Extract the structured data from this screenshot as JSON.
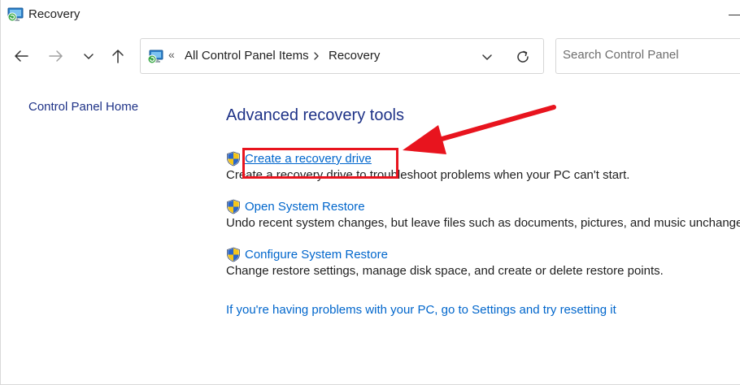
{
  "window": {
    "title": "Recovery"
  },
  "address_bar": {
    "overflow_glyph": "«",
    "crumbs": [
      "All Control Panel Items",
      "Recovery"
    ]
  },
  "search": {
    "placeholder": "Search Control Panel"
  },
  "left_pane": {
    "home_link": "Control Panel Home"
  },
  "main": {
    "title": "Advanced recovery tools",
    "tasks": [
      {
        "link": "Create a recovery drive",
        "description": "Create a recovery drive to troubleshoot problems when your PC can't start."
      },
      {
        "link": "Open System Restore",
        "description": "Undo recent system changes, but leave files such as documents, pictures, and music unchanged."
      },
      {
        "link": "Configure System Restore",
        "description": "Change restore settings, manage disk space, and create or delete restore points."
      }
    ],
    "reset_link": "If you're having problems with your PC, go to Settings and try resetting it"
  },
  "icons": {
    "title": "recovery-icon",
    "back": "arrow-left-icon",
    "forward": "arrow-right-icon",
    "recent": "chevron-down-icon",
    "up": "arrow-up-icon",
    "address_dropdown": "chevron-down-icon",
    "refresh": "refresh-icon",
    "task": "uac-shield-icon"
  },
  "colors": {
    "link": "#0066cc",
    "heading": "#1e3287",
    "annotation": "#e8141e"
  }
}
